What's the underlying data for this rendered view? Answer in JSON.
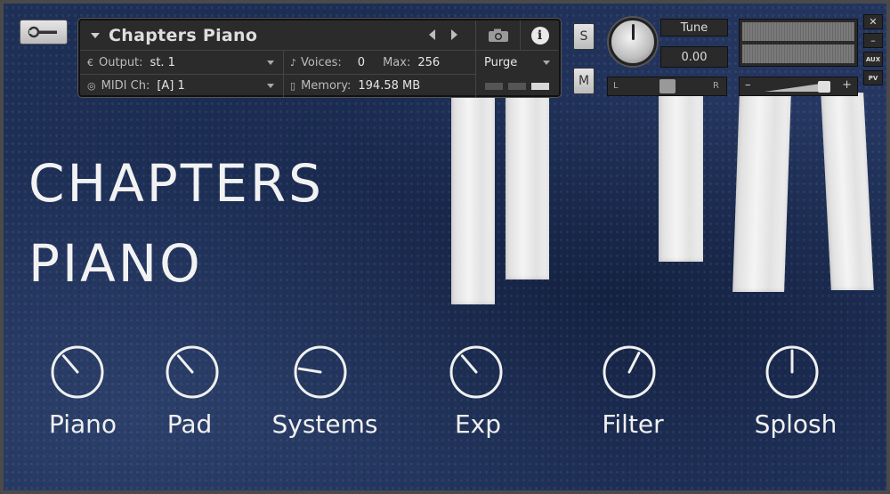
{
  "header": {
    "instrument_name": "Chapters Piano",
    "output_label": "Output:",
    "output_value": "st. 1",
    "voices_label": "Voices:",
    "voices_value": "0",
    "max_label": "Max:",
    "max_value": "256",
    "purge_label": "Purge",
    "midi_label": "MIDI Ch:",
    "midi_value": "[A]  1",
    "memory_label": "Memory:",
    "memory_value": "194.58 MB",
    "solo_label": "S",
    "mute_label": "M"
  },
  "tune": {
    "label": "Tune",
    "value": "0.00"
  },
  "pan": {
    "left_label": "L",
    "right_label": "R"
  },
  "volume": {
    "minus_label": "–",
    "plus_label": "+"
  },
  "window_buttons": {
    "close": "✕",
    "minimize": "–",
    "aux": "AUX",
    "pv": "PV"
  },
  "title": {
    "line1": "CHAPTERS",
    "line2": "PIANO"
  },
  "knobs": [
    {
      "label": "Piano",
      "value": 0.35
    },
    {
      "label": "Pad",
      "value": 0.35
    },
    {
      "label": "Systems",
      "value": 0.2
    },
    {
      "label": "Exp",
      "value": 0.35
    },
    {
      "label": "Filter",
      "value": 0.6
    },
    {
      "label": "Splosh",
      "value": 0.5
    }
  ],
  "colors": {
    "background": "#1f3057",
    "text": "#f0f0f0",
    "panel": "#2b2b2b"
  }
}
